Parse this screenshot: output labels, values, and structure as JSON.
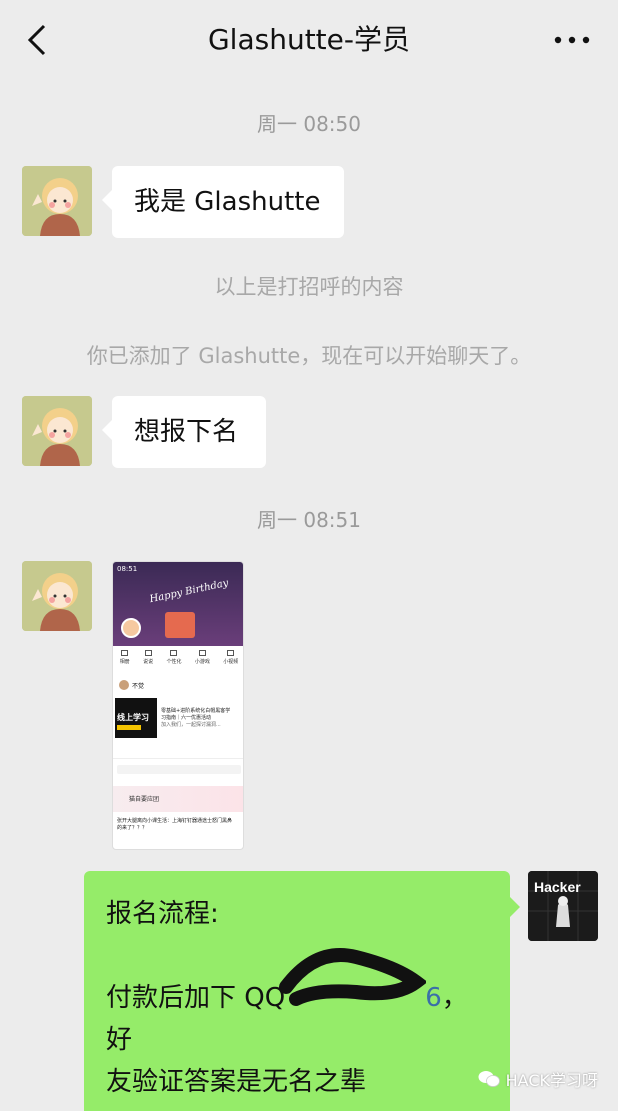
{
  "header": {
    "title": "Glashutte-学员"
  },
  "timestamps": {
    "first": "周一 08:50",
    "second": "周一 08:51"
  },
  "system": {
    "greeting_note": "以上是打招呼的内容",
    "added_note": "你已添加了 Glashutte，现在可以开始聊天了。"
  },
  "messages": {
    "m1": "我是 Glashutte",
    "m2": "想报下名",
    "reply_line1": "报名流程:",
    "reply_line2": "付款后加下 QQ",
    "reply_number_visible": "6",
    "reply_line2_end": "，好",
    "reply_line3": "友验证答案是无名之辈"
  },
  "screenshot_image": {
    "time": "08:51",
    "banner_text": "Happy Birthday",
    "icons": [
      "相册",
      "说说",
      "个性化",
      "小游戏",
      "小视频"
    ],
    "post_user": "不觉",
    "promo_badge": "线上学习",
    "promo_line1": "零基础+进阶系统化白帽黑客学",
    "promo_line2": "习指南｜六一优惠活动",
    "promo_line3": "加入我们，一起探讨漏洞...",
    "comment_title": "猫自要应团",
    "comment_line1": "张开大腿离向小课生活：上海钉钉器通途士怒门黑鼻",
    "comment_line2": "的来了？？？"
  },
  "avatar_right_label": "Hacker",
  "watermark": "HACK学习呀"
}
